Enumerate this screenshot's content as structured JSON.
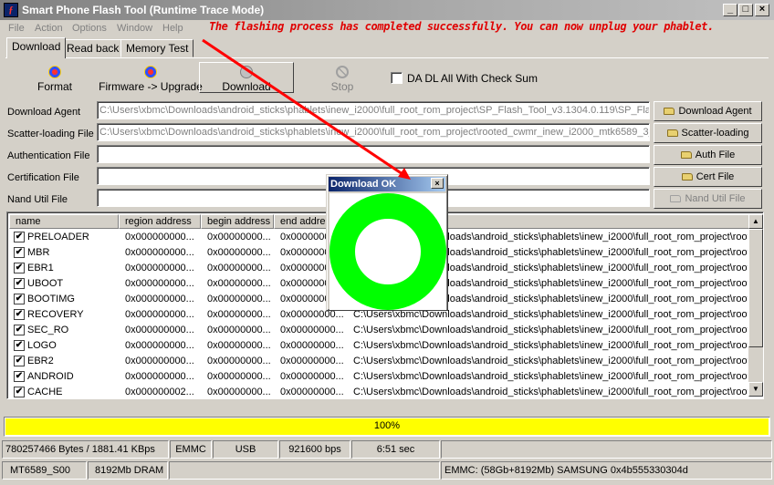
{
  "window": {
    "title": "Smart Phone Flash Tool (Runtime Trace Mode)",
    "app_icon_glyph": "ƒ",
    "minimize_glyph": "_",
    "maximize_glyph": "□",
    "close_glyph": "×"
  },
  "menu": {
    "file": "File",
    "action": "Action",
    "options": "Options",
    "window": "Window",
    "help": "Help"
  },
  "notice": "The flashing process has completed successfully.  You can now unplug your phablet.",
  "tabs": {
    "download": "Download",
    "readback": "Read back",
    "memtest": "Memory Test"
  },
  "toolbar": {
    "format": "Format",
    "firmware_upgrade": "Firmware -> Upgrade",
    "download": "Download",
    "stop": "Stop",
    "da_dl_checkbox": "DA DL All With Check Sum"
  },
  "fields": {
    "download_agent_label": "Download Agent",
    "download_agent_value": "C:\\Users\\xbmc\\Downloads\\android_sticks\\phablets\\inew_i2000\\full_root_rom_project\\SP_Flash_Tool_v3.1304.0.119\\SP_Fla",
    "scatter_label": "Scatter-loading File",
    "scatter_value": "C:\\Users\\xbmc\\Downloads\\android_sticks\\phablets\\inew_i2000\\full_root_rom_project\\rooted_cwmr_inew_i2000_mtk6589_3_",
    "auth_label": "Authentication File",
    "auth_value": "",
    "cert_label": "Certification File",
    "cert_value": "",
    "nand_label": "Nand Util File",
    "nand_value": ""
  },
  "side_buttons": {
    "download_agent": "Download Agent",
    "scatter_loading": "Scatter-loading",
    "auth_file": "Auth File",
    "cert_file": "Cert File",
    "nand_util_file": "Nand Util File"
  },
  "list": {
    "headers": [
      "name",
      "region address",
      "begin address",
      "end addre"
    ],
    "rows": [
      {
        "check": "✔",
        "name": "PRELOADER",
        "region": "0x000000000...",
        "begin": "0x00000000...",
        "end": "0x00000000...",
        "path": "C:\\Users\\xbmc\\Downloads\\android_sticks\\phablets\\inew_i2000\\full_root_rom_project\\roote"
      },
      {
        "check": "✔",
        "name": "MBR",
        "region": "0x000000000...",
        "begin": "0x00000000...",
        "end": "0x00000000...",
        "path": "C:\\Users\\xbmc\\Downloads\\android_sticks\\phablets\\inew_i2000\\full_root_rom_project\\roote"
      },
      {
        "check": "✔",
        "name": "EBR1",
        "region": "0x000000000...",
        "begin": "0x00000000...",
        "end": "0x00000000...",
        "path": "C:\\Users\\xbmc\\Downloads\\android_sticks\\phablets\\inew_i2000\\full_root_rom_project\\roote"
      },
      {
        "check": "✔",
        "name": "UBOOT",
        "region": "0x000000000...",
        "begin": "0x00000000...",
        "end": "0x00000000...",
        "path": "C:\\Users\\xbmc\\Downloads\\android_sticks\\phablets\\inew_i2000\\full_root_rom_project\\roote"
      },
      {
        "check": "✔",
        "name": "BOOTIMG",
        "region": "0x000000000...",
        "begin": "0x00000000...",
        "end": "0x00000000...",
        "path": "C:\\Users\\xbmc\\Downloads\\android_sticks\\phablets\\inew_i2000\\full_root_rom_project\\roote"
      },
      {
        "check": "✔",
        "name": "RECOVERY",
        "region": "0x000000000...",
        "begin": "0x00000000...",
        "end": "0x00000000...",
        "path": "C:\\Users\\xbmc\\Downloads\\android_sticks\\phablets\\inew_i2000\\full_root_rom_project\\roote"
      },
      {
        "check": "✔",
        "name": "SEC_RO",
        "region": "0x000000000...",
        "begin": "0x00000000...",
        "end": "0x00000000...",
        "path": "C:\\Users\\xbmc\\Downloads\\android_sticks\\phablets\\inew_i2000\\full_root_rom_project\\roote"
      },
      {
        "check": "✔",
        "name": "LOGO",
        "region": "0x000000000...",
        "begin": "0x00000000...",
        "end": "0x00000000...",
        "path": "C:\\Users\\xbmc\\Downloads\\android_sticks\\phablets\\inew_i2000\\full_root_rom_project\\roote"
      },
      {
        "check": "✔",
        "name": "EBR2",
        "region": "0x000000000...",
        "begin": "0x00000000...",
        "end": "0x00000000...",
        "path": "C:\\Users\\xbmc\\Downloads\\android_sticks\\phablets\\inew_i2000\\full_root_rom_project\\roote"
      },
      {
        "check": "✔",
        "name": "ANDROID",
        "region": "0x000000000...",
        "begin": "0x00000000...",
        "end": "0x00000000...",
        "path": "C:\\Users\\xbmc\\Downloads\\android_sticks\\phablets\\inew_i2000\\full_root_rom_project\\roote"
      },
      {
        "check": "✔",
        "name": "CACHE",
        "region": "0x000000002...",
        "begin": "0x00000000...",
        "end": "0x00000000...",
        "path": "C:\\Users\\xbmc\\Downloads\\android_sticks\\phablets\\inew_i2000\\full_root_rom_project\\roote"
      }
    ],
    "scroll_up_glyph": "▲",
    "scroll_down_glyph": "▼"
  },
  "progress": {
    "fraction": 1.0,
    "label": "100%"
  },
  "status": {
    "bytes_speed": "780257466 Bytes / 1881.41 KBps",
    "storage": "EMMC",
    "port": "USB",
    "baud": "921600 bps",
    "elapsed": "6:51 sec",
    "chip": "MT6589_S00",
    "dram": "8192Mb DRAM",
    "emmc_info": "EMMC: (58Gb+8192Mb) SAMSUNG 0x4b555330304d"
  },
  "dialog": {
    "title": "Download OK",
    "close_glyph": "×"
  },
  "colors": {
    "ok_ring": "#00ff00",
    "progress_fill": "#ffff00",
    "notice": "#e00000",
    "arrow": "#ff0000"
  },
  "icons": {
    "format": "format-icon",
    "firmware": "firmware-upgrade-icon",
    "download": "download-icon",
    "stop": "stop-icon",
    "folder": "folder-icon",
    "ok_ring": "success-ring-icon"
  }
}
